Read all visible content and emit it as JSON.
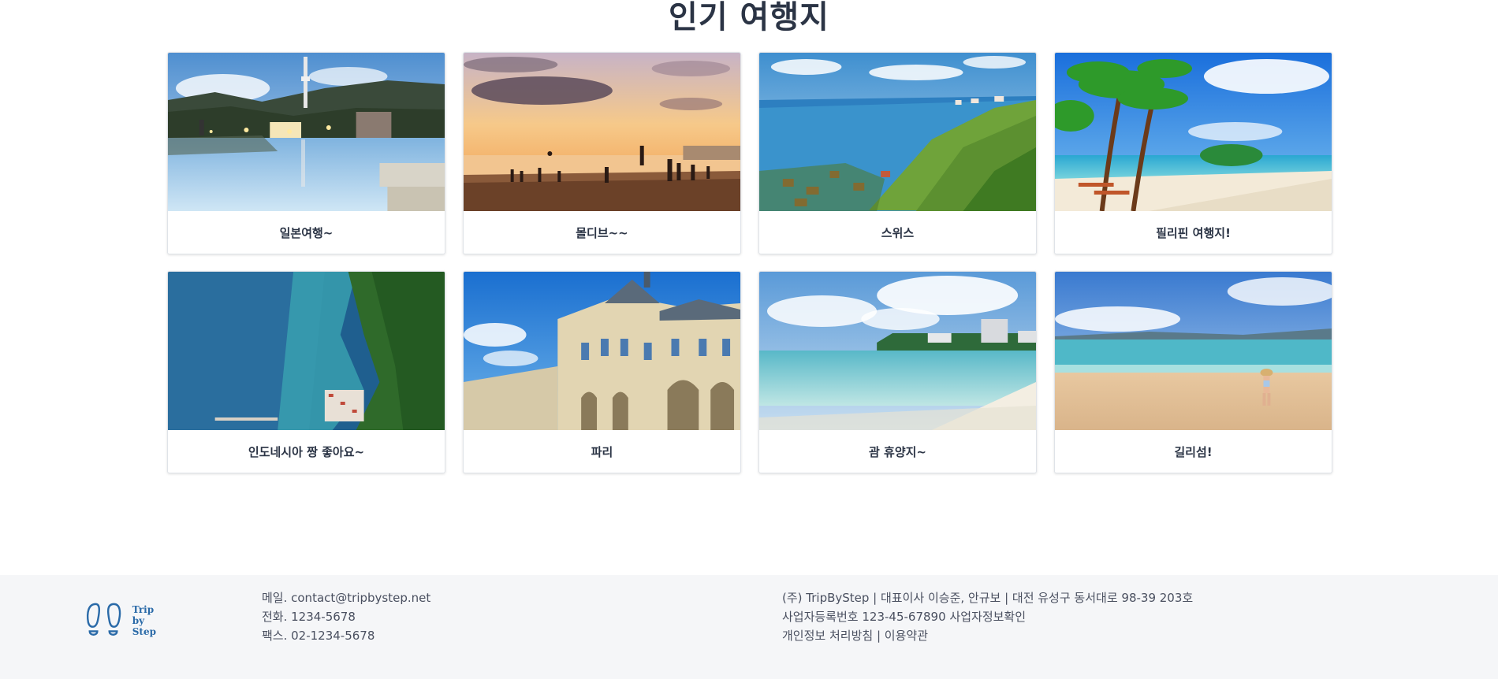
{
  "page": {
    "title": "인기 여행지"
  },
  "destinations": [
    {
      "name": "일본여행~",
      "image": "japan-night-park-lake-tower"
    },
    {
      "name": "몰디브~~",
      "image": "sunset-beach-crowd"
    },
    {
      "name": "스위스",
      "image": "swiss-vineyard-lake"
    },
    {
      "name": "필리핀 여행지!",
      "image": "palm-tree-tropical-beach"
    },
    {
      "name": "인도네시아 짱 좋아요~",
      "image": "aerial-coast-village-forest"
    },
    {
      "name": "파리",
      "image": "louvre-palace"
    },
    {
      "name": "괌 휴양지~",
      "image": "guam-beach-hotels"
    },
    {
      "name": "길리섬!",
      "image": "woman-on-beach"
    }
  ],
  "footer": {
    "logo_lines": [
      "Trip",
      "by",
      "Step"
    ],
    "email": "메일. contact@tripbystep.net",
    "phone": "전화. 1234-5678",
    "fax": "팩스. 02-1234-5678",
    "company_info": "(주) TripByStep | 대표이사 이승준, 안규보 | 대전 유성구 동서대로 98-39 203호",
    "business_number": "사업자등록번호 123-45-67890",
    "business_check_link": "사업자정보확인",
    "privacy_link": "개인정보 처리방침",
    "separator": "|",
    "terms_link": "이용약관"
  }
}
